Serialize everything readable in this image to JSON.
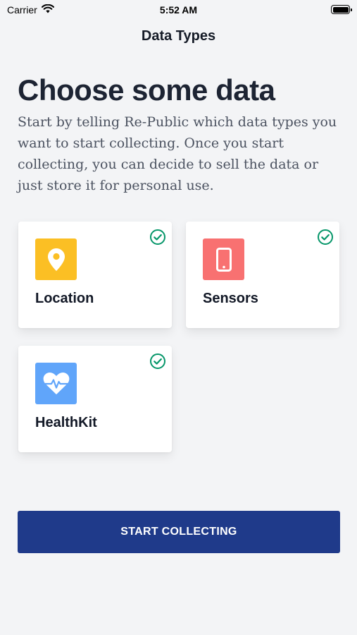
{
  "status_bar": {
    "carrier": "Carrier",
    "time": "5:52 AM",
    "wifi_icon": "wifi-icon",
    "battery_icon": "battery-icon"
  },
  "nav": {
    "title": "Data Types"
  },
  "main": {
    "heading": "Choose some data",
    "intro": "Start by telling Re-Public which data types you want to start collecting. Once you start collecting, you can decide to sell the data or just store it for personal use."
  },
  "data_types": [
    {
      "label": "Location",
      "icon": "map-pin-icon",
      "icon_color": "#fbbf24",
      "selected": true
    },
    {
      "label": "Sensors",
      "icon": "smartphone-icon",
      "icon_color": "#f87171",
      "selected": true
    },
    {
      "label": "HealthKit",
      "icon": "heart-pulse-icon",
      "icon_color": "#60a5fa",
      "selected": true
    }
  ],
  "button": {
    "label": "START COLLECTING",
    "color": "#1f3a8a"
  },
  "colors": {
    "check": "#059669",
    "background": "#f3f4f6"
  }
}
